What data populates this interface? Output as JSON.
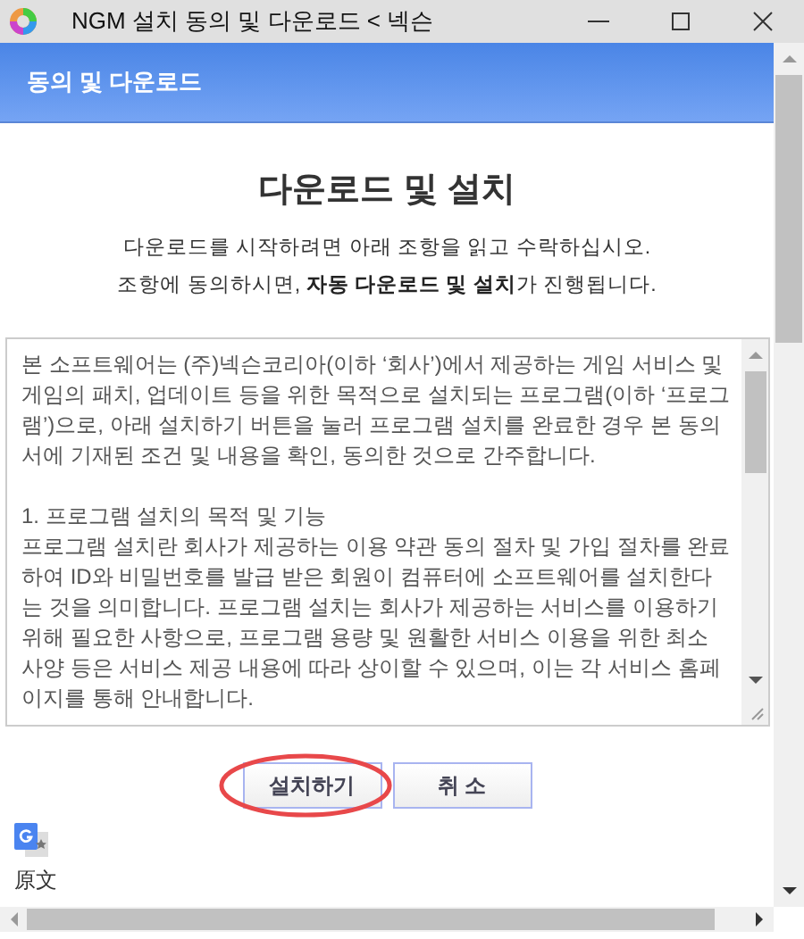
{
  "window": {
    "title": "NGM 설치 동의 및 다운로드 < 넥슨"
  },
  "header": {
    "title": "동의 및 다운로드"
  },
  "heading": "다운로드 및 설치",
  "intro": [
    "다운로드를 시작하려면 아래 조항을 읽고 수락하십시오.",
    "조항에 동의하시면, **자동 다운로드 및 설치**가 진행됩니다."
  ],
  "agreement": [
    {
      "kind": "paragraph",
      "text": "본 소프트웨어는 (주)넥슨코리아(이하 ‘회사’)에서 제공하는 게임 서비스 및 게임의 패치, 업데이트 등을 위한 목적으로 설치되는 프로그램(이하 ‘프로그램’)으로, 아래 설치하기 버튼을 눌러 프로그램 설치를 완료한 경우 본 동의서에 기재된 조건 및 내용을 확인, 동의한 것으로 간주합니다."
    },
    {
      "kind": "section-title",
      "text": "1. 프로그램 설치의 목적 및 기능"
    },
    {
      "kind": "body",
      "text": "프로그램 설치란 회사가 제공하는 이용 약관 동의 절차 및 가입 절차를 완료하여 ID와 비밀번호를 발급 받은 회원이 컴퓨터에 소프트웨어를 설치한다는 것을 의미합니다. 프로그램 설치는 회사가 제공하는 서비스를 이용하기 위해 필요한 사항으로, 프로그램 용량 및 원활한 서비스 이용을 위한 최소 사양 등은 서비스 제공 내용에 따라 상이할 수 있으며, 이는 각 서비스 홈페이지를 통해 안내합니다."
    }
  ],
  "buttons": [
    {
      "label": "설치하기",
      "highlighted": true
    },
    {
      "label": "취 소",
      "highlighted": false
    }
  ],
  "translate_label": "原文"
}
